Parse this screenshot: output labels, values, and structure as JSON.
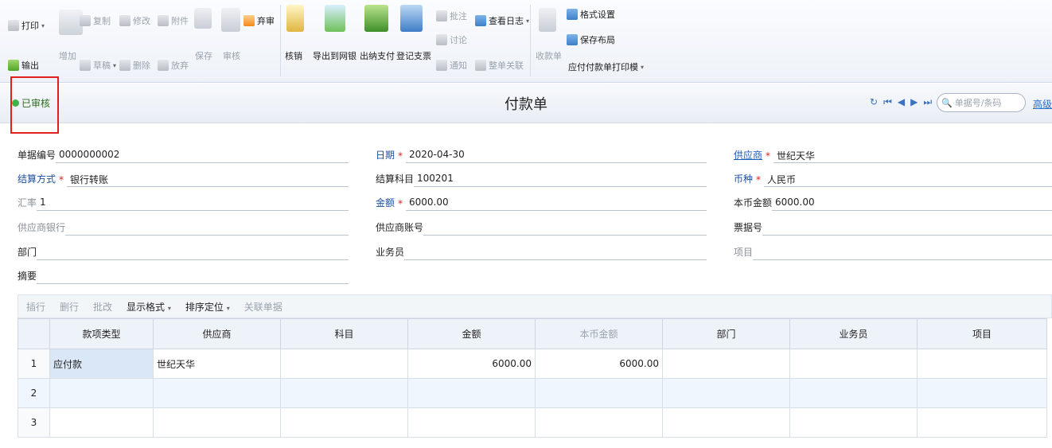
{
  "toolbar": {
    "print": "打印",
    "export": "输出",
    "add": "增加",
    "copy": "复制",
    "draft": "草稿",
    "edit": "修改",
    "delete": "删除",
    "attach": "附件",
    "abandon": "放弃",
    "save": "保存",
    "audit": "审核",
    "reject": "弃审",
    "verify": "核销",
    "export_bank": "导出到网银",
    "cashier_pay": "出纳支付",
    "register_check": "登记支票",
    "annotate": "批注",
    "discuss": "讨论",
    "notify": "通知",
    "view_log": "查看日志",
    "whole_link": "整单关联",
    "receipt": "收款单",
    "format_settings": "格式设置",
    "save_layout": "保存布局",
    "print_template": "应付付款单打印模"
  },
  "titlebar": {
    "status": "已审核",
    "title": "付款单",
    "search_placeholder": "单据号/条码",
    "advanced": "高级"
  },
  "form": {
    "doc_no_label": "单据编号",
    "doc_no_value": "0000000002",
    "date_label": "日期",
    "date_value": "2020-04-30",
    "supplier_label": "供应商",
    "supplier_value": "世纪天华",
    "settle_method_label": "结算方式",
    "settle_method_value": "银行转账",
    "settle_account_label": "结算科目",
    "settle_account_value": "100201",
    "currency_label": "币种",
    "currency_value": "人民币",
    "rate_label": "汇率",
    "rate_value": "1",
    "amount_label": "金额",
    "amount_value": "6000.00",
    "local_amount_label": "本币金额",
    "local_amount_value": "6000.00",
    "supplier_bank_label": "供应商银行",
    "supplier_account_label": "供应商账号",
    "bill_no_label": "票据号",
    "department_label": "部门",
    "salesman_label": "业务员",
    "project_label": "项目",
    "summary_label": "摘要"
  },
  "grid_toolbar": {
    "insert_row": "插行",
    "delete_row": "删行",
    "batch_edit": "批改",
    "display_format": "显示格式",
    "sort_locate": "排序定位",
    "linked_docs": "关联单据"
  },
  "grid": {
    "columns": [
      "款项类型",
      "供应商",
      "科目",
      "金额",
      "本币金额",
      "部门",
      "业务员",
      "项目"
    ],
    "rows": [
      {
        "idx": "1",
        "type": "应付款",
        "supplier": "世纪天华",
        "account": "",
        "amount": "6000.00",
        "local_amount": "6000.00",
        "dept": "",
        "salesman": "",
        "project": ""
      },
      {
        "idx": "2",
        "type": "",
        "supplier": "",
        "account": "",
        "amount": "",
        "local_amount": "",
        "dept": "",
        "salesman": "",
        "project": ""
      },
      {
        "idx": "3",
        "type": "",
        "supplier": "",
        "account": "",
        "amount": "",
        "local_amount": "",
        "dept": "",
        "salesman": "",
        "project": ""
      }
    ]
  }
}
